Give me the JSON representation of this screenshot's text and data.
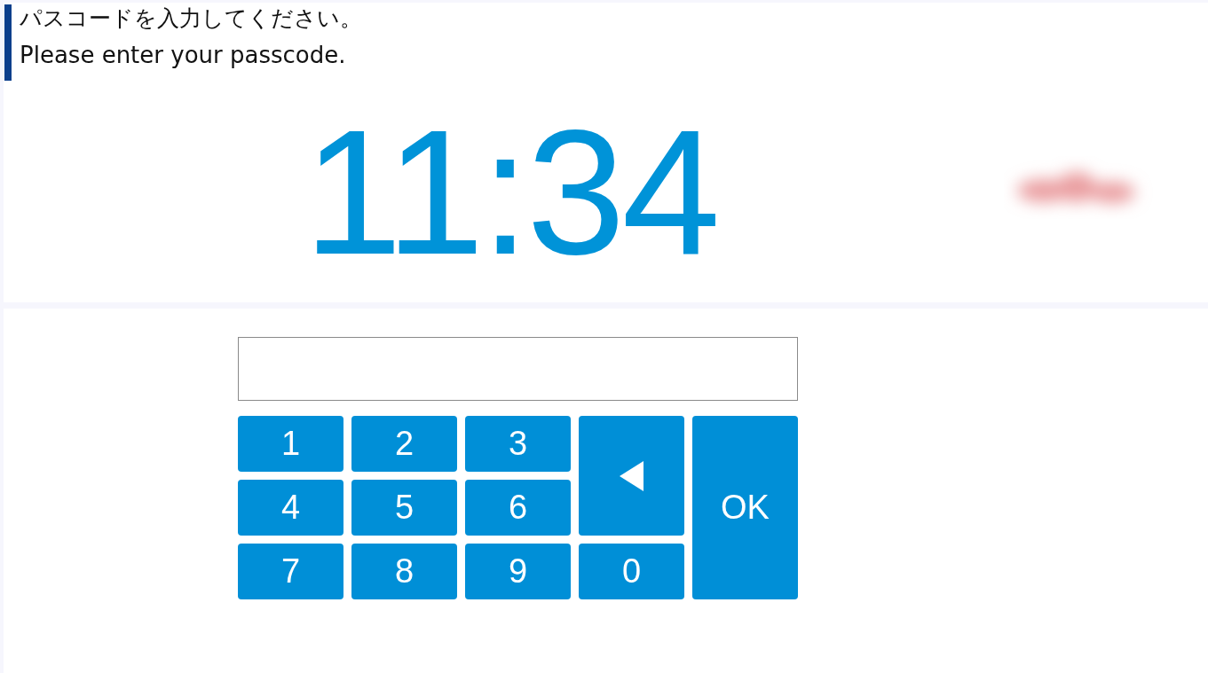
{
  "prompt": {
    "japanese": "パスコードを入力してください。",
    "english": "Please enter your passcode."
  },
  "clock": {
    "time": "11:34"
  },
  "keypad": {
    "keys": [
      {
        "kind": "digit",
        "label": "1"
      },
      {
        "kind": "digit",
        "label": "2"
      },
      {
        "kind": "digit",
        "label": "3"
      },
      {
        "kind": "backspace"
      },
      {
        "kind": "digit",
        "label": "4"
      },
      {
        "kind": "digit",
        "label": "5"
      },
      {
        "kind": "digit",
        "label": "6"
      },
      {
        "kind": "confirm",
        "label": "OK"
      },
      {
        "kind": "digit",
        "label": "7"
      },
      {
        "kind": "digit",
        "label": "8"
      },
      {
        "kind": "digit",
        "label": "9"
      },
      {
        "kind": "digit",
        "label": "0"
      }
    ]
  }
}
